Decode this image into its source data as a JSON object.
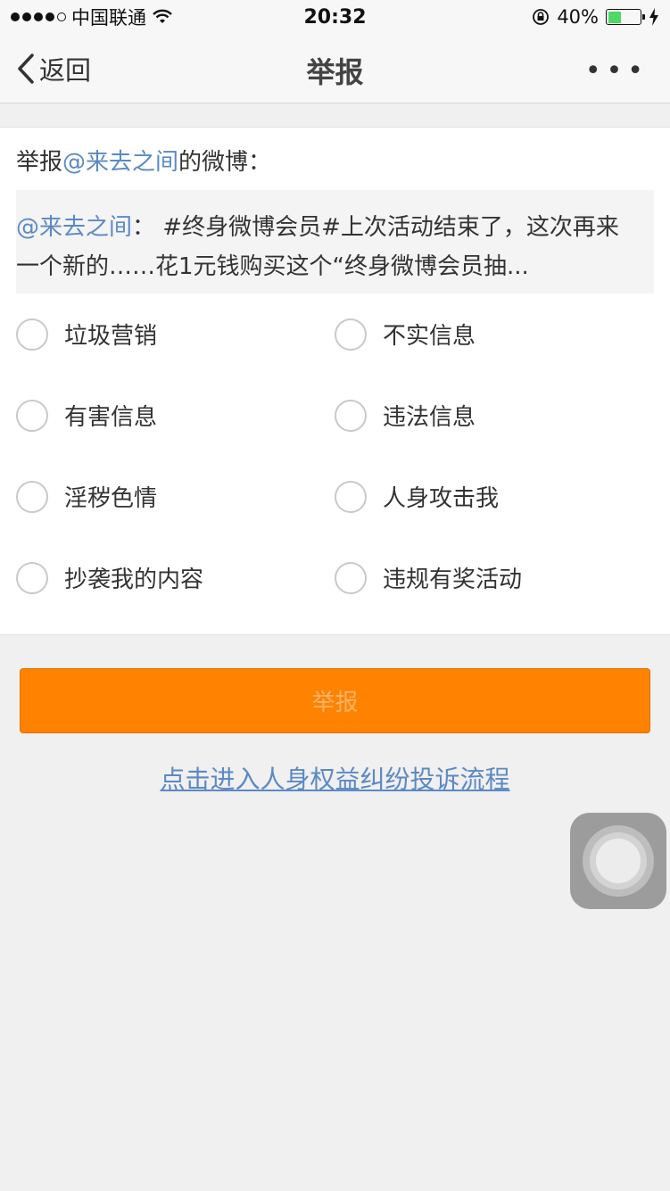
{
  "status_bar": {
    "carrier": "中国联通",
    "time": "20:32",
    "battery": "40%",
    "battery_level": 0.4,
    "icons": [
      "signal-dots",
      "wifi-icon",
      "orientation-lock-icon",
      "battery-icon",
      "charging-bolt-icon"
    ]
  },
  "nav": {
    "back_label": "返回",
    "title": "举报",
    "more_label": "•••"
  },
  "report": {
    "heading_prefix": "举报",
    "heading_user": "@来去之间",
    "heading_suffix": "的微博：",
    "quote_user": "@来去之间",
    "quote_colon": "：",
    "quote_line1": "  #终身微博会员#上次活动结束了，这次再来",
    "quote_line2": "一个新的……花1元钱购买这个“终身微博会员抽..."
  },
  "options": [
    {
      "label": "垃圾营销"
    },
    {
      "label": "不实信息"
    },
    {
      "label": "有害信息"
    },
    {
      "label": "违法信息"
    },
    {
      "label": "淫秽色情"
    },
    {
      "label": "人身攻击我"
    },
    {
      "label": "抄袭我的内容"
    },
    {
      "label": "违规有奖活动"
    }
  ],
  "submit_label": "举报",
  "complaint_link": "点击进入人身权益纠纷投诉流程",
  "colors": {
    "accent_orange": "#ff8200",
    "link_blue": "#5b89c4",
    "battery_green": "#4cd964"
  }
}
